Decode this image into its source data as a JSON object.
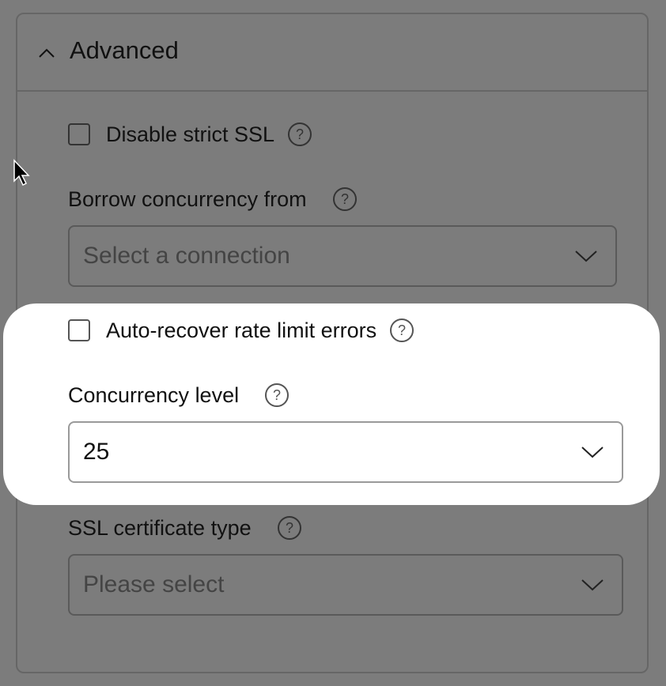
{
  "panel": {
    "title": "Advanced"
  },
  "fields": {
    "disable_ssl": {
      "label": "Disable strict SSL",
      "checked": false
    },
    "borrow": {
      "label": "Borrow concurrency from",
      "placeholder": "Select a connection"
    },
    "auto_recover": {
      "label": "Auto-recover rate limit errors",
      "checked": false
    },
    "concurrency": {
      "label": "Concurrency level",
      "value": "25"
    },
    "ssl_cert": {
      "label": "SSL certificate type",
      "placeholder": "Please select"
    }
  },
  "icons": {
    "collapse": "chevron-up-icon",
    "help": "question-circle-icon",
    "dropdown": "chevron-down-icon",
    "cursor": "mouse-pointer-icon"
  },
  "colors": {
    "overlay": "#7c7c7c",
    "highlight": "#ffffff",
    "text": "#111111",
    "placeholder": "#444444"
  }
}
